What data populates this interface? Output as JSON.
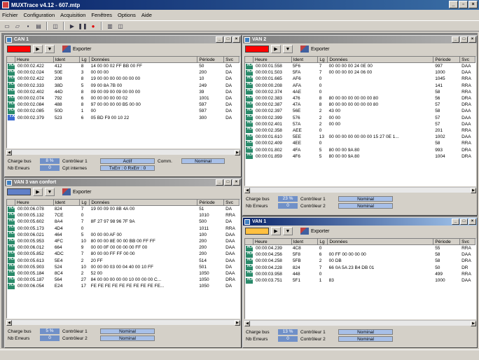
{
  "app": {
    "title": "MUXTrace v4.12 - 607.mtp"
  },
  "menu": [
    "Fichier",
    "Configuration",
    "Acquisition",
    "Fenêtres",
    "Options",
    "Aide"
  ],
  "export_label": "Exporter",
  "headers": [
    "Heure",
    "Ident",
    "Lg",
    "Données",
    "Période",
    "Svc"
  ],
  "colors": {
    "active_title": "#0a246a",
    "rx_icon": "#2a8a6a",
    "tx_icon": "#3a6ad0",
    "badge": "#7090c8"
  },
  "can1": {
    "title": "CAN 1",
    "color": "#ff0000",
    "rows": [
      [
        "00:00:02.422",
        "412",
        "8",
        "14 00 00 02 FF BB 00 FF",
        "50",
        "DA"
      ],
      [
        "00:00:02.024",
        "50E",
        "3",
        "00 00 00",
        "200",
        "DA"
      ],
      [
        "00:00:02.422",
        "208",
        "8",
        "19 00 00 00 00 00 00 00",
        "10",
        "DA"
      ],
      [
        "00:00:02.333",
        "38D",
        "5",
        "09 00 8A 7B 00",
        "249",
        "DA"
      ],
      [
        "00:00:02.402",
        "44D",
        "8",
        "09 00 09 00 09 00 00 00",
        "39",
        "DA"
      ],
      [
        "00:00:02.074",
        "792",
        "6",
        "00 00 00 00 00 02",
        "1001",
        "DA"
      ],
      [
        "00:00:02.084",
        "488",
        "8",
        "97 00 00 00 00 B5 00 00",
        "597",
        "DA"
      ],
      [
        "00:00:02.085",
        "50D",
        "1",
        "00",
        "597",
        "DA"
      ],
      [
        "00:00:02.379",
        "523",
        "6",
        "05 BD F9 00 10 22",
        "300",
        "DA"
      ]
    ],
    "footer": {
      "charge_label": "Charge bus",
      "charge": "8 %",
      "ctrl_label": "Contrôleur 1",
      "ctrl_state": "Actif",
      "comm_label": "Comm.",
      "comm_state": "Nominal",
      "err_label": "Nb Erreurs",
      "err": "0",
      "cpt_label": "Cpt internes",
      "cpt": "TxErr : 0 RxErr : 0"
    }
  },
  "van3": {
    "title": "VAN 3 van confort",
    "color": "#6080c8",
    "rows": [
      [
        "00:00:06.078",
        "824",
        "7",
        "19 00 09 00 8B 4A 00",
        "51",
        "DA"
      ],
      [
        "00:00:05.132",
        "7CE",
        "0",
        "",
        "1010",
        "RRA"
      ],
      [
        "00:00:05.602",
        "8A4",
        "7",
        "8F 27 97 98 96 7F 9A",
        "500",
        "DA"
      ],
      [
        "00:00:05.173",
        "4D4",
        "0",
        "",
        "1011",
        "RRA"
      ],
      [
        "00:00:06.021",
        "464",
        "5",
        "00 00 00 AF 00",
        "100",
        "DAA"
      ],
      [
        "00:00:05.953",
        "4FC",
        "10",
        "80 00 00 8E 00 00 BB 00 FF FF",
        "200",
        "DAA"
      ],
      [
        "00:00:06.012",
        "664",
        "9",
        "00 00 0F 00 00 00 00 FF 00",
        "200",
        "DAA"
      ],
      [
        "00:00:05.852",
        "4DC",
        "7",
        "80 00 00 FF FF 00 00",
        "200",
        "DAA"
      ],
      [
        "00:00:05.613",
        "5E4",
        "2",
        "20 FF",
        "514",
        "DAA"
      ],
      [
        "00:00:05.903",
        "524",
        "10",
        "00 00 00 03 00 04 40 00 10 FF",
        "501",
        "DA"
      ],
      [
        "00:00:05.184",
        "8C4",
        "2",
        "52 00",
        "1050",
        "DAA"
      ],
      [
        "00:00:05.187",
        "564",
        "27",
        "84 00 00 00 00 00 10 00 00 00 C...",
        "1050",
        "DRA"
      ],
      [
        "00:00:06.054",
        "E24",
        "17",
        "FE FE FE FE FE FE FE FE FE FE...",
        "1050",
        "DA"
      ]
    ],
    "footer": {
      "charge_label": "Charge bus",
      "charge": "5 %",
      "c1_label": "Contrôleur 1",
      "c1": "Nominal",
      "err_label": "Nb Erreurs",
      "err": "0",
      "c2_label": "Contrôleur 2",
      "c2": "Nominal"
    }
  },
  "van2": {
    "title": "VAN 2",
    "color": "#ff0000",
    "rows": [
      [
        "00:00:01.558",
        "5F6",
        "7",
        "00 00 00 00 24 0E 00",
        "997",
        "DAA"
      ],
      [
        "00:00:01.503",
        "5FA",
        "7",
        "00 00 00 00 24 06 00",
        "1000",
        "DAA"
      ],
      [
        "00:00:01.665",
        "AF6",
        "0",
        "",
        "1045",
        "RRA"
      ],
      [
        "00:00:00.208",
        "AFA",
        "0",
        "",
        "141",
        "RRA"
      ],
      [
        "00:00:02.374",
        "4AE",
        "0",
        "",
        "58",
        "RRA"
      ],
      [
        "00:00:02.383",
        "476",
        "8",
        "80 00 00 00 00 00 00 80",
        "56",
        "DRA"
      ],
      [
        "00:00:02.387",
        "47A",
        "8",
        "80 00 00 00 00 00 00 80",
        "57",
        "DRA"
      ],
      [
        "00:00:02.397",
        "56E",
        "2",
        "43 00",
        "58",
        "DAA"
      ],
      [
        "00:00:02.399",
        "576",
        "2",
        "00 00",
        "57",
        "DAA"
      ],
      [
        "00:00:02.401",
        "57A",
        "2",
        "00 00",
        "57",
        "DAA"
      ],
      [
        "00:00:02.358",
        "AEE",
        "0",
        "",
        "201",
        "RRA"
      ],
      [
        "00:00:01.610",
        "5EE",
        "13",
        "00 00 00 00 00 00 00 15 27 0E 1...",
        "1002",
        "DAA"
      ],
      [
        "00:00:02.409",
        "4EE",
        "0",
        "",
        "58",
        "RRA"
      ],
      [
        "00:00:01.802",
        "4FA",
        "5",
        "80 00 00 9A 80",
        "993",
        "DRA"
      ],
      [
        "00:00:01.859",
        "4F6",
        "5",
        "80 00 00 9A 80",
        "1004",
        "DRA"
      ]
    ],
    "footer": {
      "charge_label": "Charge bus",
      "charge": "23 %",
      "c1_label": "Contrôleur 1",
      "c1": "Nominal",
      "err_label": "Nb Erreurs",
      "err": "0",
      "c2_label": "Contrôleur 2",
      "c2": "Nominal"
    }
  },
  "van1": {
    "title": "VAN 1",
    "color": "#ffc040",
    "rows": [
      [
        "00:00:04.239",
        "4C8",
        "0",
        "",
        "55",
        "RRA"
      ],
      [
        "00:00:04.256",
        "5F8",
        "6",
        "00 FF 00 00 00 00",
        "58",
        "DAA"
      ],
      [
        "00:00:04.258",
        "5FB",
        "2",
        "00 DB",
        "58",
        "DRA"
      ],
      [
        "00:00:04.228",
        "824",
        "7",
        "66 0A 5A 23 B4 DB 01",
        "50",
        "DR"
      ],
      [
        "00:00:03.958",
        "448",
        "0",
        "",
        "499",
        "RRA"
      ],
      [
        "00:00:03.751",
        "5F1",
        "1",
        "83",
        "1000",
        "DAA"
      ]
    ],
    "footer": {
      "charge_label": "Charge bus",
      "charge": "13 %",
      "c1_label": "Contrôleur 1",
      "c1": "Nominal",
      "err_label": "Nb Erreurs",
      "err": "0",
      "c2_label": "Contrôleur 2",
      "c2": "Nominal"
    }
  }
}
